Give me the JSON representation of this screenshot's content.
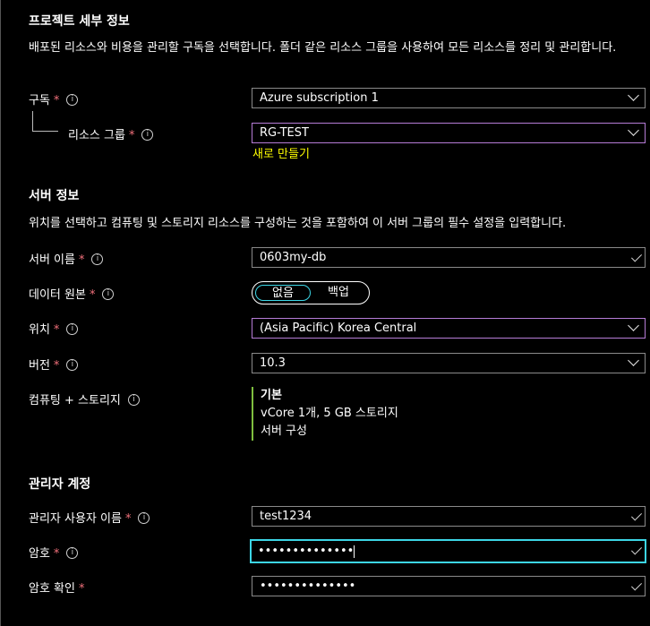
{
  "project": {
    "title": "프로젝트 세부 정보",
    "description": "배포된 리소스와 비용을 관리할 구독을 선택합니다. 폴더 같은 리소스 그룹을 사용하여 모든 리소스를 정리 및 관리합니다.",
    "subscription_label": "구독",
    "subscription_value": "Azure subscription 1",
    "resource_group_label": "리소스 그룹",
    "resource_group_value": "RG-TEST",
    "create_new": "새로 만들기"
  },
  "server": {
    "title": "서버 정보",
    "description": "위치를 선택하고 컴퓨팅 및 스토리지 리소스를 구성하는 것을 포함하여 이 서버 그룹의 필수 설정을 입력합니다.",
    "name_label": "서버 이름",
    "name_value": "0603my-db",
    "source_label": "데이터 원본",
    "source_options": [
      "없음",
      "백업"
    ],
    "source_selected": "없음",
    "location_label": "위치",
    "location_value": "(Asia Pacific) Korea Central",
    "version_label": "버전",
    "version_value": "10.3",
    "compute_label": "컴퓨팅 + 스토리지",
    "compute_tier": "기본",
    "compute_detail": "vCore 1개, 5 GB 스토리지",
    "compute_link": "서버 구성"
  },
  "admin": {
    "title": "관리자 계정",
    "username_label": "관리자 사용자 이름",
    "username_value": "test1234",
    "password_label": "암호",
    "password_value": "••••••••••••••",
    "confirm_label": "암호 확인",
    "confirm_value": "••••••••••••••"
  },
  "required_mark": "*",
  "info_glyph": "i",
  "colors": {
    "background": "#000000",
    "required": "#f1707b",
    "link": "#ffff00",
    "focus": "#3cd6e6",
    "dropdown_accent": "#b67cd6",
    "compute_bar": "#7fbf3f"
  }
}
